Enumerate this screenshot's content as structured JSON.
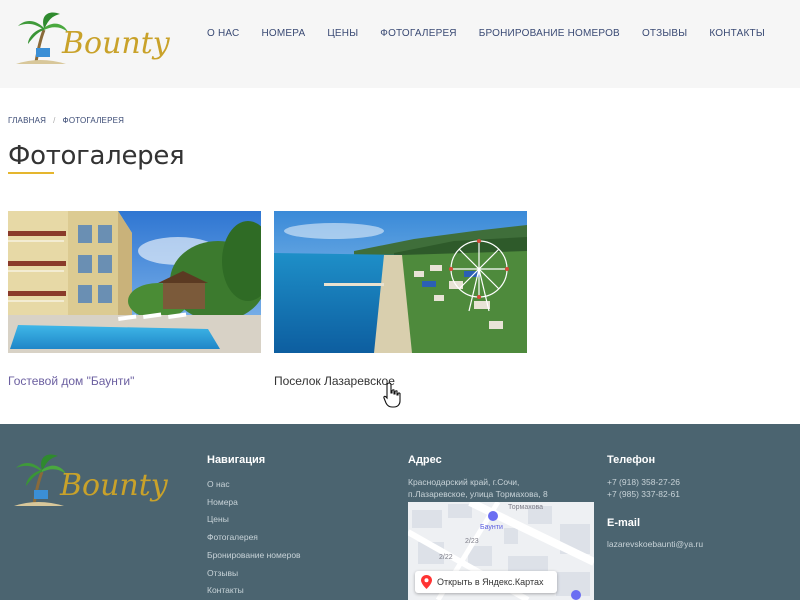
{
  "header": {
    "logo_text": "Bounty",
    "nav": [
      "О НАС",
      "НОМЕРА",
      "ЦЕНЫ",
      "ФОТОГАЛЕРЕЯ",
      "БРОНИРОВАНИЕ НОМЕРОВ",
      "ОТЗЫВЫ",
      "КОНТАКТЫ"
    ]
  },
  "breadcrumb": {
    "home": "ГЛАВНАЯ",
    "separator": "/",
    "current": "ФОТОГАЛЕРЕЯ"
  },
  "page_title": "Фотогалерея",
  "gallery": [
    {
      "caption": "Гостевой дом \"Баунти\""
    },
    {
      "caption": "Поселок Лазаревское"
    }
  ],
  "footer": {
    "logo_text": "Bounty",
    "nav_title": "Навигация",
    "nav_links": [
      "О нас",
      "Номера",
      "Цены",
      "Фотогалерея",
      "Бронирование номеров",
      "Отзывы",
      "Контакты"
    ],
    "address_title": "Адрес",
    "address_line1": "Краснодарский край, г.Сочи,",
    "address_line2": "п.Лазаревское, улица Тормахова, 8",
    "map_button": "Открыть в Яндекс.Картах",
    "map_labels": {
      "street": "Тормахова",
      "poi": "Баунти",
      "house1": "2/23",
      "house2": "2/22"
    },
    "phone_title": "Телефон",
    "phones": [
      "+7 (918) 358-27-26",
      "+7 (985) 337-82-61"
    ],
    "email_title": "E-mail",
    "email": "lazarevskoebaunti@ya.ru"
  },
  "colors": {
    "header_bg": "#f6f6f6",
    "footer_bg": "#4b6470",
    "accent_underline": "#e5b62e",
    "nav_text": "#3a4a74",
    "link_purple": "#6b5fa0"
  }
}
